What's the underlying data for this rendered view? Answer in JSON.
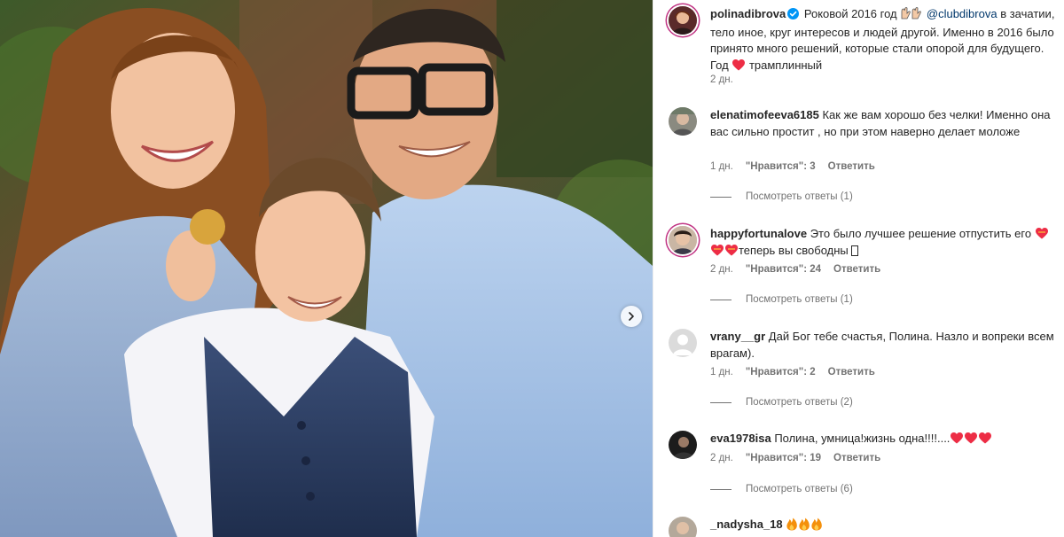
{
  "post": {
    "author": "polinadibrova",
    "caption_part1": "Роковой 2016 год",
    "caption_mention": "@clubdibrova",
    "caption_part2": "в зачатии, тело иное, круг интересов и людей другой. Именно в 2016 было принято много решений, которые стали опорой для будущего. Год",
    "caption_part3": "трамплинный",
    "time": "2 дн."
  },
  "labels": {
    "like": "\"Нравится\":",
    "reply": "Ответить"
  },
  "comments": [
    {
      "username": "elenatimofeeva6185",
      "text": "Как же вам хорошо без челки! Именно она вас сильно простит , но при этом наверно делает моложе",
      "time": "1 дн.",
      "likes": "3",
      "replies_label": "Посмотреть ответы (1)"
    },
    {
      "username": "happyfortunalove",
      "text_part1": "Это было лучшее решение отпустить его",
      "text_part2": "теперь вы свободны",
      "time": "2 дн.",
      "likes": "24",
      "replies_label": "Посмотреть ответы (1)"
    },
    {
      "username": "vrany__gr",
      "text": "Дай Бог тебе счастья, Полина. Назло и вопреки всем врагам).",
      "time": "1 дн.",
      "likes": "2",
      "replies_label": "Посмотреть ответы (2)"
    },
    {
      "username": "eva1978isa",
      "text": "Полина, умница!жизнь одна!!!!....",
      "time": "2 дн.",
      "likes": "19",
      "replies_label": "Посмотреть ответы (6)"
    },
    {
      "username": "_nadysha_18",
      "text": ""
    }
  ],
  "colors": {
    "heart_red": "#ed2d45",
    "verified_blue": "#0095f6",
    "link_blue": "#00376b",
    "muted_gray": "#737373"
  },
  "icons": {
    "carousel": "chevron-right-icon",
    "verified": "verified-badge-icon",
    "heart": "red-heart-icon",
    "fire": "fire-icon",
    "hands": "raised-hands-icon"
  }
}
